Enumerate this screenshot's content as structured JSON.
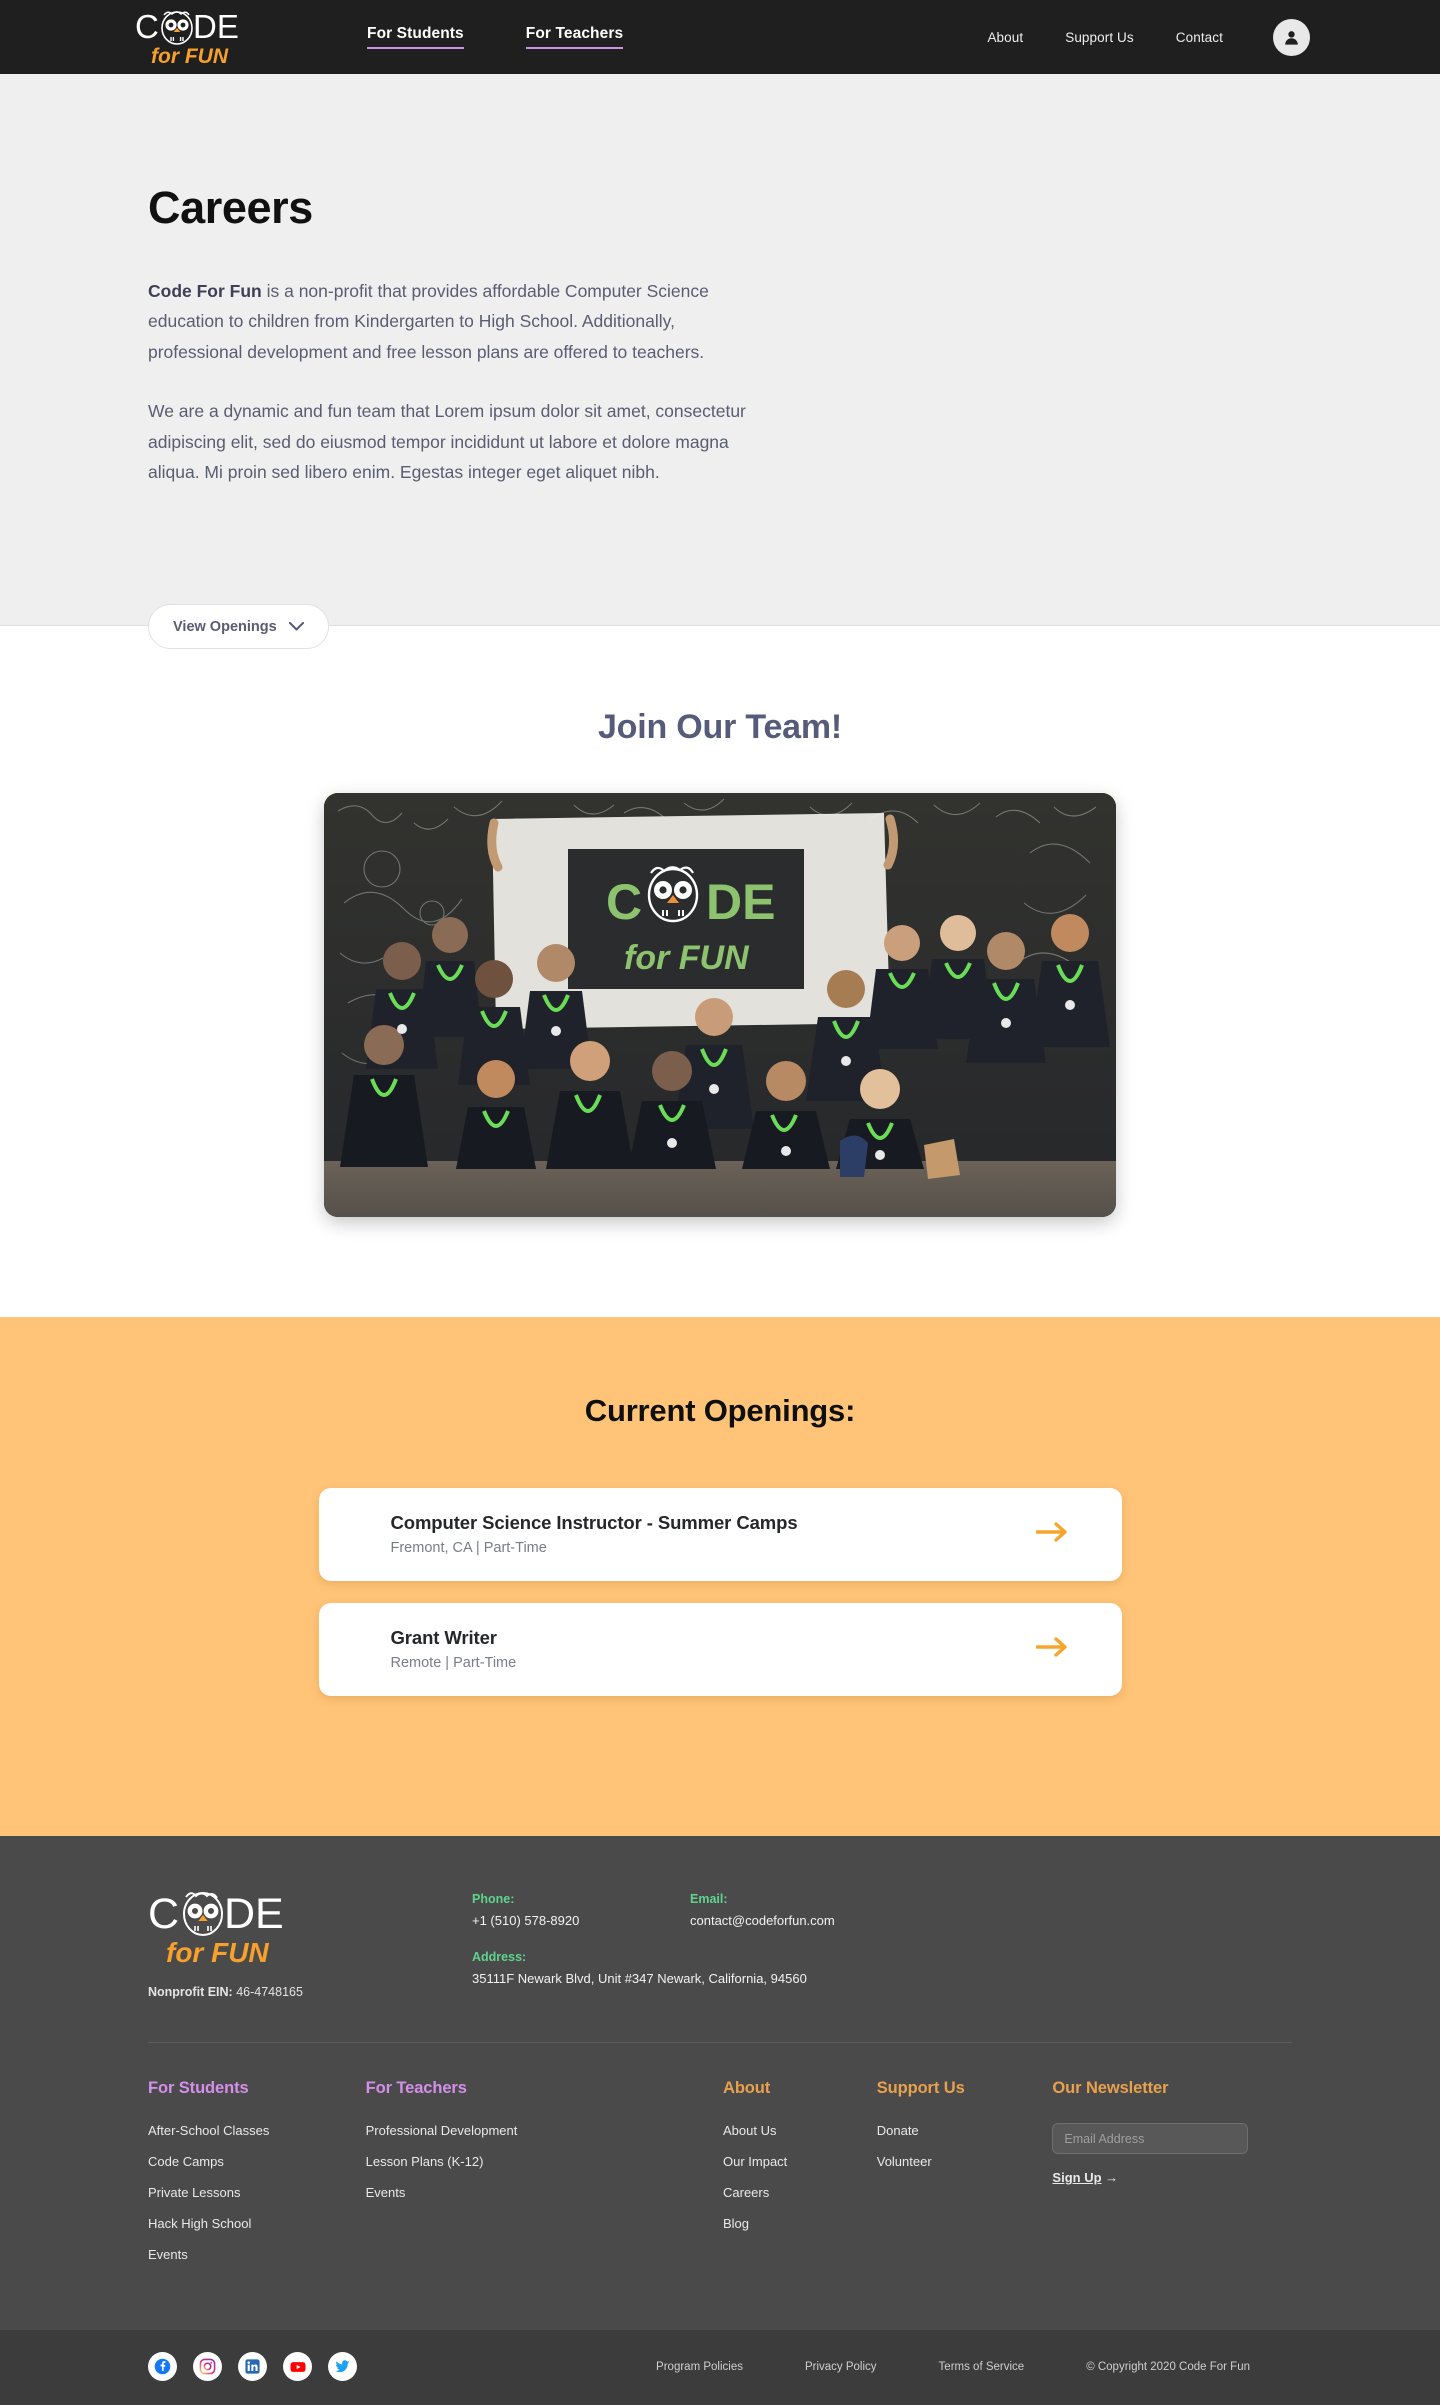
{
  "brand": {
    "logo_word": "CODE",
    "logo_sub": "for FUN",
    "owl_icon": "owl-icon",
    "accent_orange": "#F7A12C",
    "accent_purple": "#C792E8",
    "accent_green": "#5FD38D"
  },
  "header": {
    "nav_primary": [
      {
        "label": "For Students",
        "name": "nav-for-students"
      },
      {
        "label": "For Teachers",
        "name": "nav-for-teachers"
      }
    ],
    "nav_secondary": [
      {
        "label": "About",
        "name": "nav-about"
      },
      {
        "label": "Support Us",
        "name": "nav-support-us"
      },
      {
        "label": "Contact",
        "name": "nav-contact"
      }
    ],
    "account_icon": "user-account-icon"
  },
  "hero": {
    "title": "Careers",
    "para1_bold": "Code For Fun",
    "para1_rest": " is a non-profit that provides affordable Computer Science education to children from Kindergarten to High School. Additionally,  professional development and free lesson plans are offered to teachers.",
    "para2": "We are a dynamic and fun team that Lorem ipsum dolor sit amet, consectetur adipiscing elit, sed do eiusmod tempor incididunt ut labore et dolore magna aliqua. Mi proin sed libero enim. Egestas integer eget aliquet nibh.",
    "view_openings_label": "View Openings",
    "chevron_icon": "chevron-down-icon",
    "background_color": "#EFEFEF"
  },
  "team": {
    "title": "Join Our Team!",
    "photo_alt": "Code For Fun team group photo in front of a chalkboard wall",
    "photo_banner_word": "CODE",
    "photo_banner_sub": "for FUN"
  },
  "openings": {
    "title": "Current Openings:",
    "background_color": "#FFC477",
    "arrow_icon": "arrow-right-icon",
    "jobs": [
      {
        "title": "Computer Science Instructor - Summer Camps",
        "location": "Fremont, CA",
        "type": "Part-Time",
        "meta": "Fremont, CA  |  Part-Time"
      },
      {
        "title": "Grant Writer",
        "location": "Remote",
        "type": "Part-Time",
        "meta": "Remote  |  Part-Time"
      }
    ]
  },
  "footer": {
    "background_color": "#4A4A4A",
    "ein_label": "Nonprofit EIN:",
    "ein_value": " 46-4748165",
    "contact": {
      "phone_label": "Phone:",
      "phone_value": "+1 (510) 578-8920",
      "email_label": "Email:",
      "email_value": "contact@codeforfun.com",
      "address_label": "Address:",
      "address_value": "35111F Newark Blvd, Unit #347 Newark, California, 94560"
    },
    "columns": [
      {
        "heading": "For Students",
        "links": [
          "After-School Classes",
          "Code Camps",
          "Private Lessons",
          "Hack High School",
          "Events"
        ]
      },
      {
        "heading": "For Teachers",
        "links": [
          "Professional Development",
          "Lesson Plans (K-12)",
          "Events"
        ]
      },
      {
        "heading": "About",
        "links": [
          "About Us",
          "Our Impact",
          "Careers",
          "Blog"
        ]
      },
      {
        "heading": "Support Us",
        "links": [
          "Donate",
          "Volunteer"
        ]
      }
    ],
    "newsletter": {
      "heading": "Our Newsletter",
      "placeholder": "Email Address",
      "value": "",
      "signup_label": "Sign Up",
      "signup_arrow": "→"
    },
    "socials": [
      {
        "name": "facebook-icon",
        "label": "Facebook"
      },
      {
        "name": "instagram-icon",
        "label": "Instagram"
      },
      {
        "name": "linkedin-icon",
        "label": "LinkedIn"
      },
      {
        "name": "youtube-icon",
        "label": "YouTube"
      },
      {
        "name": "twitter-icon",
        "label": "Twitter"
      }
    ],
    "legal": [
      "Program Policies",
      "Privacy Policy",
      "Terms of Service"
    ],
    "copyright": "© Copyright 2020 Code For Fun"
  }
}
